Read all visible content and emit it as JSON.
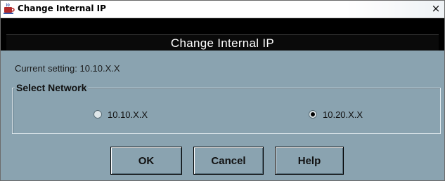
{
  "window": {
    "title": "Change Internal IP",
    "close_glyph": "×",
    "app_icon": "java-app-icon",
    "close_icon": "close-icon"
  },
  "header": {
    "title": "Change Internal IP"
  },
  "current_setting": {
    "text": "Current setting: 10.10.X.X"
  },
  "network_group": {
    "legend": "Select Network",
    "options": [
      {
        "label": "10.10.X.X",
        "selected": false
      },
      {
        "label": "10.20.X.X",
        "selected": true
      }
    ]
  },
  "buttons": {
    "ok": "OK",
    "cancel": "Cancel",
    "help": "Help"
  },
  "colors": {
    "dialog_bg": "#8aa3b0",
    "header_bg": "#000000",
    "header_text": "#ffffff"
  }
}
